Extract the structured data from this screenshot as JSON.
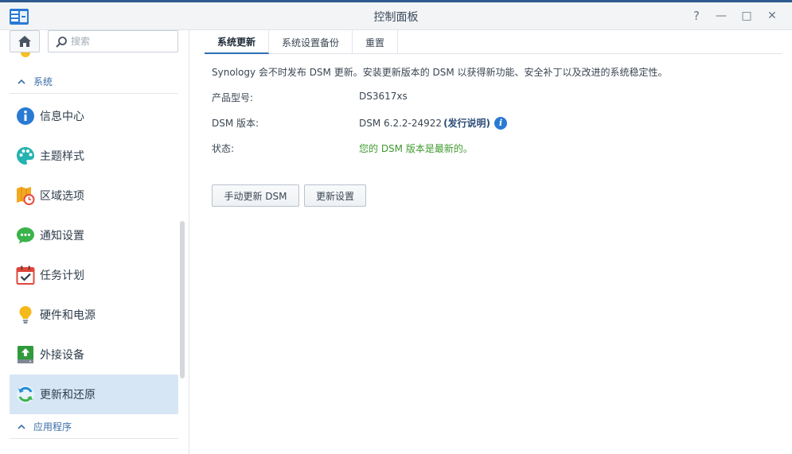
{
  "window": {
    "title": "控制面板"
  },
  "window_controls": {
    "help": "?",
    "minimize": "—",
    "maximize": "□",
    "close": "✕"
  },
  "sidebar": {
    "search_placeholder": "搜索",
    "groups": [
      {
        "label": "系统"
      },
      {
        "label": "应用程序"
      }
    ],
    "items": [
      {
        "label": "信息中心",
        "icon": "info-icon"
      },
      {
        "label": "主题样式",
        "icon": "palette-icon"
      },
      {
        "label": "区域选项",
        "icon": "map-clock-icon"
      },
      {
        "label": "通知设置",
        "icon": "chat-bubble-icon"
      },
      {
        "label": "任务计划",
        "icon": "calendar-check-icon"
      },
      {
        "label": "硬件和电源",
        "icon": "lightbulb-icon"
      },
      {
        "label": "外接设备",
        "icon": "external-device-icon"
      },
      {
        "label": "更新和还原",
        "icon": "refresh-icon",
        "active": true
      }
    ]
  },
  "tabs": [
    {
      "label": "系统更新",
      "active": true
    },
    {
      "label": "系统设置备份"
    },
    {
      "label": "重置"
    }
  ],
  "content": {
    "description": "Synology 会不时发布 DSM 更新。安装更新版本的 DSM 以获得新功能、安全补丁以及改进的系统稳定性。",
    "model_label": "产品型号:",
    "model_value": "DS3617xs",
    "version_label": "DSM 版本:",
    "version_value": "DSM 6.2.2-24922",
    "release_notes": "(发行说明)",
    "status_label": "状态:",
    "status_value": "您的 DSM 版本是最新的。"
  },
  "buttons": {
    "manual_update": "手动更新 DSM",
    "update_settings": "更新设置"
  },
  "colors": {
    "accent": "#2f6eb5",
    "status_ok": "#3f9a2f",
    "active_bg": "#d7e6f5"
  }
}
